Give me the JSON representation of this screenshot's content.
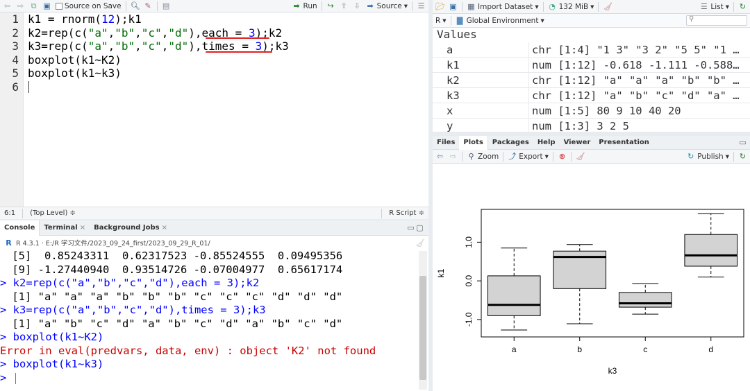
{
  "editor": {
    "toolbar": {
      "source_on_save": "Source on Save",
      "run": "Run",
      "source": "Source"
    },
    "lines": [
      "1",
      "2",
      "3",
      "4",
      "5",
      "6"
    ],
    "code": [
      {
        "a": "k1 = rnorm(",
        "b": "12",
        "c": ");k1"
      },
      {
        "a": "k2=rep(c(",
        "s1": "\"a\"",
        "s2": "\"b\"",
        "s3": "\"c\"",
        "s4": "\"d\"",
        "mid": "),each = ",
        "n": "3",
        "end": ");k2"
      },
      {
        "a": "k3=rep(c(",
        "s1": "\"a\"",
        "s2": "\"b\"",
        "s3": "\"c\"",
        "s4": "\"d\"",
        "mid": "),times = ",
        "n": "3",
        "end": ");k3"
      },
      {
        "a": "boxplot(k1~K2)"
      },
      {
        "a": "boxplot(k1~k3)"
      }
    ],
    "status": {
      "position": "6:1",
      "level": "(Top Level) ≑",
      "type": "R Script ≑"
    }
  },
  "console": {
    "tabs": [
      "Console",
      "Terminal",
      "Background Jobs"
    ],
    "path": "R 4.3.1 · E:/R 学习文件/2023_09_24_first/2023_09_29_R_01/",
    "lines": [
      {
        "t": " [5]  0.85243311  0.62317523 -0.85524555  0.09495356",
        "k": "cblack"
      },
      {
        "t": " [9] -1.27440940  0.93514726 -0.07004977  0.65617174",
        "k": "cblack"
      },
      {
        "t": "> k2=rep(c(\"a\",\"b\",\"c\",\"d\"),each = 3);k2",
        "k": "cblue"
      },
      {
        "t": " [1] \"a\" \"a\" \"a\" \"b\" \"b\" \"b\" \"c\" \"c\" \"c\" \"d\" \"d\" \"d\"",
        "k": "cblack"
      },
      {
        "t": "> k3=rep(c(\"a\",\"b\",\"c\",\"d\"),times = 3);k3",
        "k": "cblue"
      },
      {
        "t": " [1] \"a\" \"b\" \"c\" \"d\" \"a\" \"b\" \"c\" \"d\" \"a\" \"b\" \"c\" \"d\"",
        "k": "cblack"
      },
      {
        "t": "> boxplot(k1~K2)",
        "k": "cblue"
      },
      {
        "t": "Error in eval(predvars, data, env) : object 'K2' not found",
        "k": "cred"
      },
      {
        "t": "> boxplot(k1~k3)",
        "k": "cblue"
      },
      {
        "t": "> ",
        "k": "cblue"
      }
    ]
  },
  "environment": {
    "toolbar": {
      "import": "Import Dataset",
      "memory": "132 MiB",
      "view": "List"
    },
    "scope": "Global Environment",
    "lang": "R",
    "header": "Values",
    "rows": [
      {
        "name": "a",
        "value": "chr [1:4] \"1 3\" \"3 2\" \"5 5\" \"1 …"
      },
      {
        "name": "k1",
        "value": "num [1:12] -0.618 -1.111 -0.588…"
      },
      {
        "name": "k2",
        "value": "chr [1:12] \"a\" \"a\" \"a\" \"b\" \"b\" …"
      },
      {
        "name": "k3",
        "value": "chr [1:12] \"a\" \"b\" \"c\" \"d\" \"a\" …"
      },
      {
        "name": "x",
        "value": "num [1:5] 80 9 10 40 20"
      },
      {
        "name": "y",
        "value": "num [1:3] 3 2 5"
      }
    ]
  },
  "plots": {
    "tabs": [
      "Files",
      "Plots",
      "Packages",
      "Help",
      "Viewer",
      "Presentation"
    ],
    "toolbar": {
      "zoom": "Zoom",
      "export": "Export",
      "publish": "Publish"
    }
  },
  "chart_data": {
    "type": "boxplot",
    "categories": [
      "a",
      "b",
      "c",
      "d"
    ],
    "xlabel": "k3",
    "ylabel": "k1",
    "yticks": [
      "-1.0",
      "0.0",
      "1.0"
    ],
    "ylim": [
      -1.45,
      1.85
    ],
    "boxes": [
      {
        "min": -1.27,
        "q1": -0.9,
        "median": -0.62,
        "q3": 0.13,
        "max": 0.85
      },
      {
        "min": -1.11,
        "q1": -0.2,
        "median": 0.62,
        "q3": 0.77,
        "max": 0.94
      },
      {
        "min": -0.86,
        "q1": -0.68,
        "median": -0.58,
        "q3": -0.3,
        "max": -0.07
      },
      {
        "min": 0.1,
        "q1": 0.38,
        "median": 0.66,
        "q3": 1.2,
        "max": 1.74
      }
    ]
  }
}
